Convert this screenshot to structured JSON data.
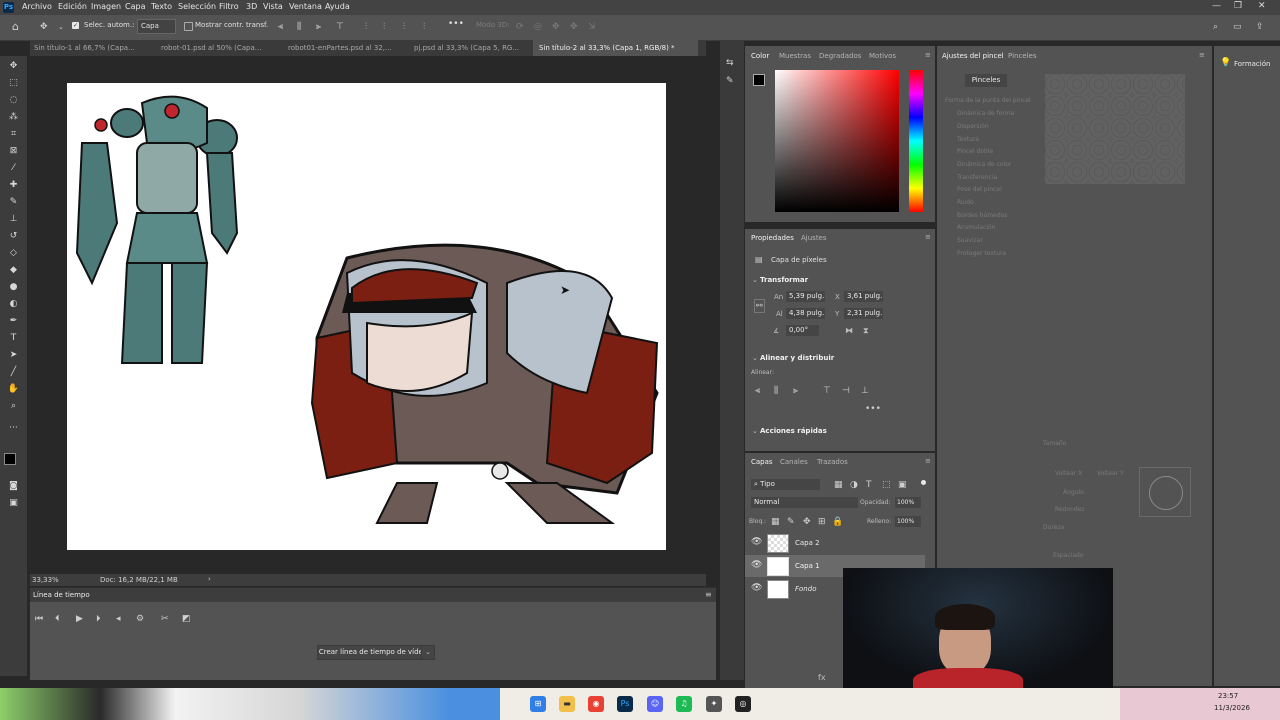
{
  "app": {
    "logo": "Ps"
  },
  "menu": [
    "Archivo",
    "Edición",
    "Imagen",
    "Capa",
    "Texto",
    "Selección",
    "Filtro",
    "3D",
    "Vista",
    "Ventana",
    "Ayuda"
  ],
  "options_bar": {
    "auto_select_label": "Selec. autom.:",
    "auto_select_value": "Capa",
    "show_transform_label": "Mostrar contr. transf.",
    "mode_3d_label": "Modo 3D:",
    "more": "•••"
  },
  "tabs": [
    {
      "label": "Sin título-1 al 66,7% (Capa..."
    },
    {
      "label": "robot-01.psd al 50% (Capa..."
    },
    {
      "label": "robot01-enPartes.psd al 32,..."
    },
    {
      "label": "pj.psd al 33,3% (Capa 5, RG..."
    },
    {
      "label": "Sin título-2 al 33,3% (Capa 1, RGB/8) *"
    }
  ],
  "status": {
    "zoom": "33,33%",
    "doc": "Doc: 16,2 MB/22,1 MB"
  },
  "timeline": {
    "title": "Línea de tiempo",
    "create_button": "Crear línea de tiempo de vídeo"
  },
  "color_panel": {
    "tabs": [
      "Color",
      "Muestras",
      "Degradados",
      "Motivos"
    ]
  },
  "properties": {
    "tabs": [
      "Propiedades",
      "Ajustes"
    ],
    "type": "Capa de píxeles",
    "transform_title": "Transformar",
    "w_label": "An",
    "w": "5,39 pulg.",
    "x_label": "X",
    "x": "3,61 pulg.",
    "h_label": "Al",
    "h": "4,38 pulg.",
    "y_label": "Y",
    "y": "2,31 pulg.",
    "angle": "0,00°",
    "align_title": "Alinear y distribuir",
    "align_label": "Alinear:",
    "quick_actions": "Acciones rápidas"
  },
  "layers": {
    "tabs": [
      "Capas",
      "Canales",
      "Trazados"
    ],
    "filter_label": "Tipo",
    "blend_mode": "Normal",
    "opacity_label": "Opacidad:",
    "opacity": "100%",
    "lock_label": "Bloq.:",
    "fill_label": "Relleno:",
    "fill": "100%",
    "items": [
      {
        "name": "Capa 2"
      },
      {
        "name": "Capa 1"
      },
      {
        "name": "Fondo"
      }
    ]
  },
  "brush_settings": {
    "tabs": [
      "Ajustes del pincel",
      "Pinceles"
    ],
    "brushes_button": "Pinceles",
    "options": [
      "Forma de la punta del pincel",
      "Dinámica de forma",
      "Dispersión",
      "Textura",
      "Pincel doble",
      "Dinámica de color",
      "Transferencia",
      "Pose del pincel",
      "Ruido",
      "Bordes húmedos",
      "Acumulación",
      "Suavizar",
      "Proteger textura"
    ],
    "size_label": "Tamaño",
    "flip_x": "Voltear X",
    "flip_y": "Voltear Y",
    "angle_label": "Ángulo",
    "roundness_label": "Redondez",
    "hardness_label": "Dureza",
    "spacing_label": "Espaciado"
  },
  "learn_panel": {
    "title": "Formación"
  },
  "clock": {
    "time": "23:57",
    "date": "11/3/2026"
  }
}
